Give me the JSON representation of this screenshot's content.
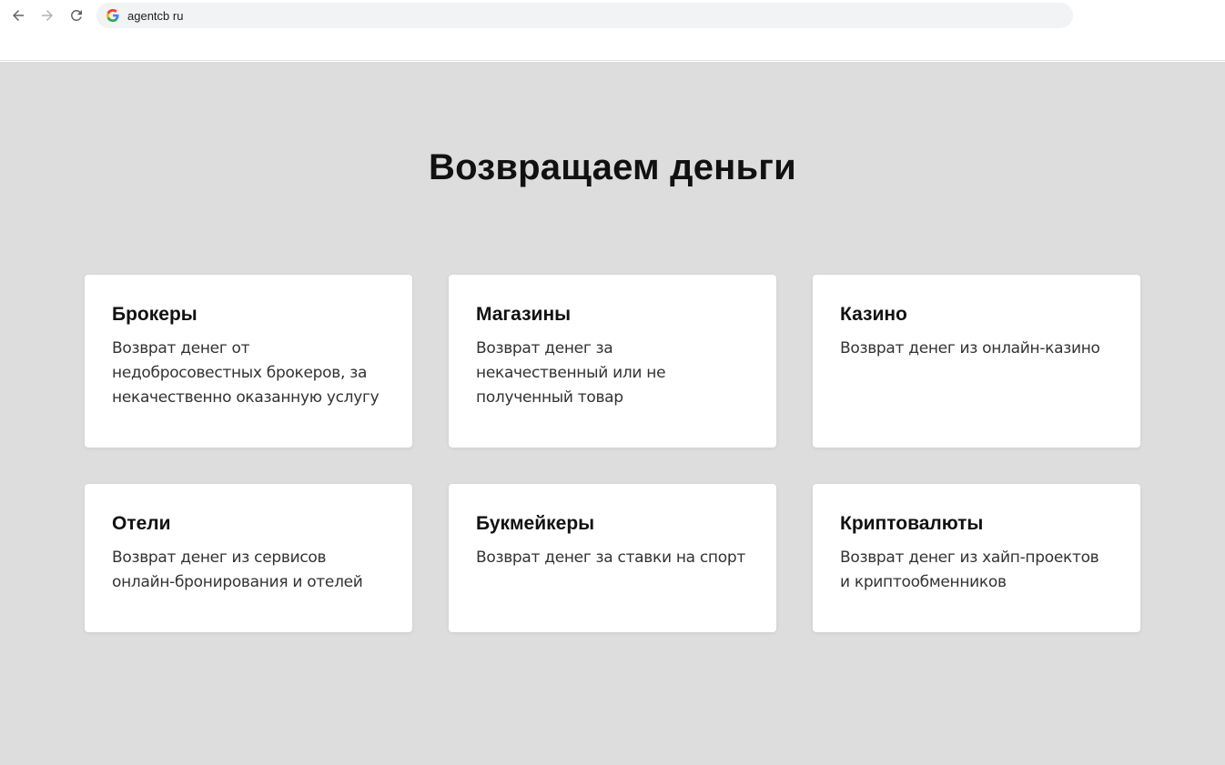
{
  "browser": {
    "url": "agentcb ru",
    "icons": {
      "back": "back-arrow-icon",
      "forward": "forward-arrow-icon",
      "reload": "reload-icon",
      "site": "google-icon"
    }
  },
  "page": {
    "background": "#dddddd",
    "title": "Возвращаем деньги",
    "cards": [
      {
        "title": "Брокеры",
        "text": "Возврат денег от недобросовестных брокеров, за некачественно оказанную услугу"
      },
      {
        "title": "Магазины",
        "text": "Возврат денег за некачественный или не полученный товар"
      },
      {
        "title": "Казино",
        "text": "Возврат денег из онлайн-казино"
      },
      {
        "title": "Отели",
        "text": "Возврат денег из сервисов онлайн-бронирования и отелей"
      },
      {
        "title": "Букмейкеры",
        "text": "Возврат денег за ставки на спорт"
      },
      {
        "title": "Криптовалюты",
        "text": "Возврат денег из хайп-проектов и криптообменников"
      }
    ]
  }
}
